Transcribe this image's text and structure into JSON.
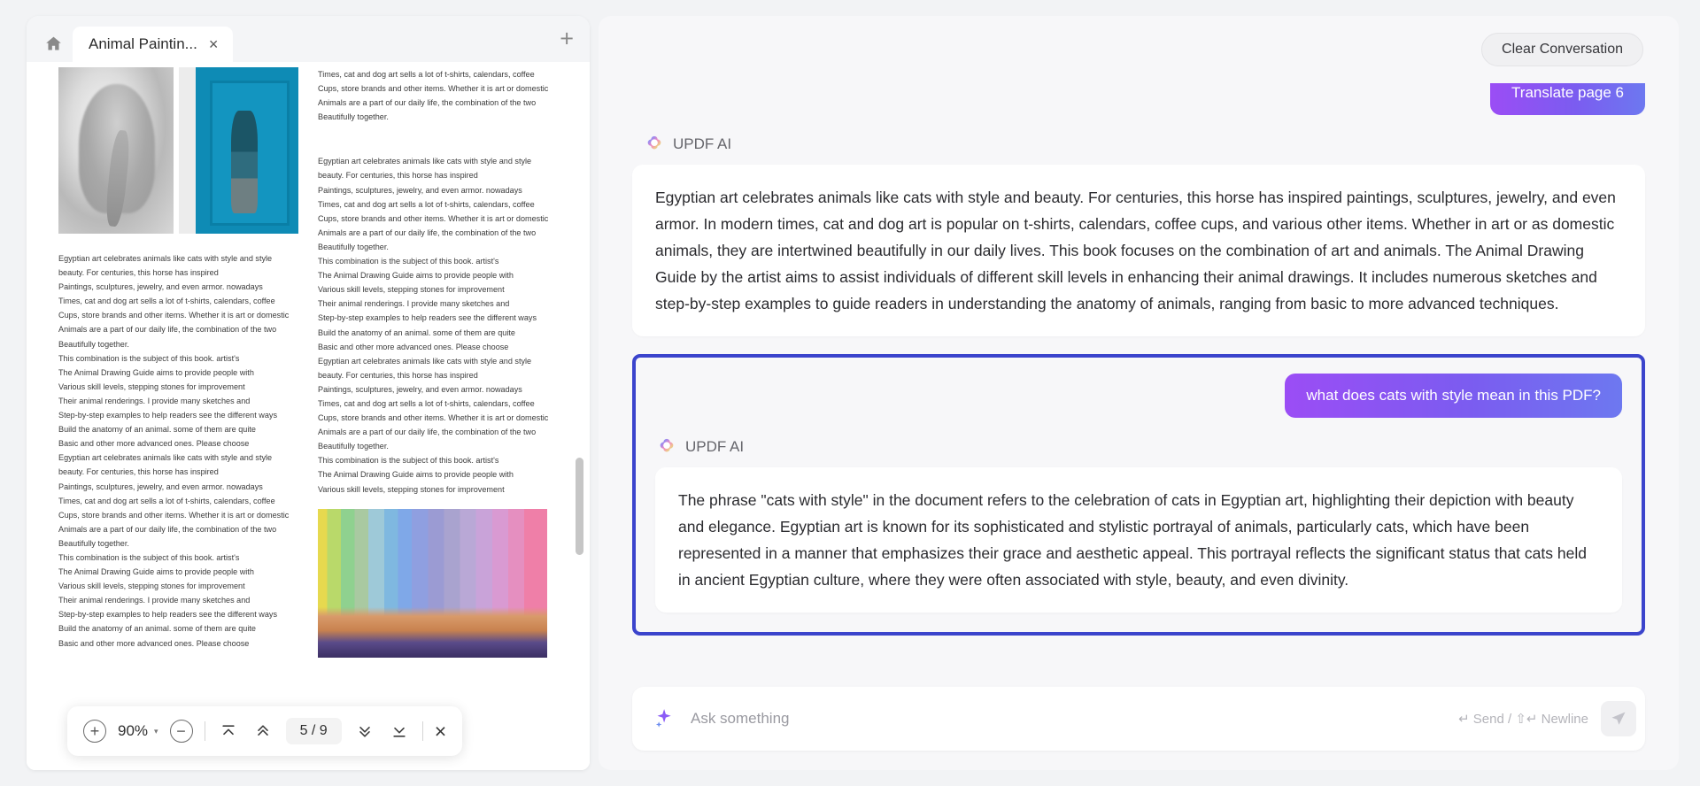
{
  "viewer": {
    "home_icon": "home-icon",
    "tab": {
      "title": "Animal Paintin...",
      "close": "×"
    },
    "new_tab": "+",
    "toolbar": {
      "zoom_in": "+",
      "zoom_level": "90%",
      "zoom_caret": "▾",
      "zoom_out": "−",
      "first_page": "first-page-icon",
      "prev_page": "prev-page-icon",
      "page_indicator": "5 / 9",
      "next_page": "next-page-icon",
      "last_page": "last-page-icon",
      "close": "×"
    },
    "document": {
      "left_column": [
        "Egyptian art celebrates animals like cats with style and style",
        "beauty. For centuries, this horse has inspired",
        "Paintings, sculptures, jewelry, and even armor. nowadays",
        "Times, cat and dog art sells a lot of t-shirts, calendars, coffee",
        "Cups, store brands and other items. Whether it is art or domestic",
        "Animals are a part of our daily life, the combination of the two",
        "Beautifully together.",
        "This combination is the subject of this book. artist's",
        "The Animal Drawing Guide aims to provide people with",
        "Various skill levels, stepping stones for improvement",
        "Their animal renderings. I provide many sketches and",
        "Step-by-step examples to help readers see the different ways",
        "Build the anatomy of an animal. some of them are quite",
        "Basic and other more advanced ones. Please choose",
        "Egyptian art celebrates animals like cats with style and style",
        "beauty. For centuries, this horse has inspired",
        "Paintings, sculptures, jewelry, and even armor. nowadays",
        "Times, cat and dog art sells a lot of t-shirts, calendars, coffee",
        "Cups, store brands and other items. Whether it is art or domestic",
        "Animals are a part of our daily life, the combination of the two",
        "Beautifully together.",
        "This combination is the subject of this book. artist's",
        "The Animal Drawing Guide aims to provide people with",
        "Various skill levels, stepping stones for improvement",
        "Their animal renderings. I provide many sketches and",
        "Step-by-step examples to help readers see the different ways",
        "Build the anatomy of an animal. some of them are quite",
        "Basic and other more advanced ones. Please choose"
      ],
      "right_column_top": [
        "Times, cat and dog art sells a lot of t-shirts, calendars, coffee",
        "Cups, store brands and other items. Whether it is art or domestic",
        "Animals are a part of our daily life, the combination of the two",
        "Beautifully together."
      ],
      "right_column_body": [
        "Egyptian art celebrates animals like cats with style and style",
        "beauty. For centuries, this horse has inspired",
        "Paintings, sculptures, jewelry, and even armor. nowadays",
        "Times, cat and dog art sells a lot of t-shirts, calendars, coffee",
        "Cups, store brands and other items. Whether it is art or domestic",
        "Animals are a part of our daily life, the combination of the two",
        "Beautifully together.",
        "This combination is the subject of this book. artist's",
        "The Animal Drawing Guide aims to provide people with",
        "Various skill levels, stepping stones for improvement",
        "Their animal renderings. I provide many sketches and",
        "Step-by-step examples to help readers see the different ways",
        "Build the anatomy of an animal. some of them are quite",
        "Basic and other more advanced ones. Please choose",
        "Egyptian art celebrates animals like cats with style and style",
        "beauty. For centuries, this horse has inspired",
        "Paintings, sculptures, jewelry, and even armor. nowadays",
        "Times, cat and dog art sells a lot of t-shirts, calendars, coffee",
        "Cups, store brands and other items. Whether it is art or domestic",
        "Animals are a part of our daily life, the combination of the two",
        "Beautifully together.",
        "This combination is the subject of this book. artist's",
        "The Animal Drawing Guide aims to provide people with",
        "Various skill levels, stepping stones for improvement"
      ]
    }
  },
  "chat": {
    "clear_label": "Clear Conversation",
    "ai_name": "UPDF AI",
    "messages": {
      "user_prev": "Translate page 6",
      "ai_first": "Egyptian art celebrates animals like cats with style and beauty. For centuries, this horse has inspired paintings, sculptures, jewelry, and even armor. In modern times, cat and dog art is popular on t-shirts, calendars, coffee cups, and various other items. Whether in art or as domestic animals, they are intertwined beautifully in our daily lives. This book focuses on the combination of art and animals. The Animal Drawing Guide by the artist aims to assist individuals of different skill levels in enhancing their animal drawings. It includes numerous sketches and step-by-step examples to guide readers in understanding the anatomy of animals, ranging from basic to more advanced techniques.",
      "user_question": "what does cats with style mean in this PDF?",
      "ai_second": "The phrase \"cats with style\" in the document refers to the celebration of cats in Egyptian art, highlighting their depiction with beauty and elegance. Egyptian art is known for its sophisticated and stylistic portrayal of animals, particularly cats, which have been represented in a manner that emphasizes their grace and aesthetic appeal. This portrayal reflects the significant status that cats held in ancient Egyptian culture, where they were often associated with style, beauty, and even divinity."
    },
    "input": {
      "placeholder": "Ask something",
      "value": "",
      "hint": "↵ Send / ⇧↵ Newline",
      "send_icon": "send-icon",
      "spark_icon": "sparkle-icon"
    }
  },
  "colors": {
    "highlight_border": "#3b44cc",
    "user_bubble_start": "#9b4df5",
    "user_bubble_end": "#6d78f0",
    "page_bg": "#f2f3f5"
  }
}
